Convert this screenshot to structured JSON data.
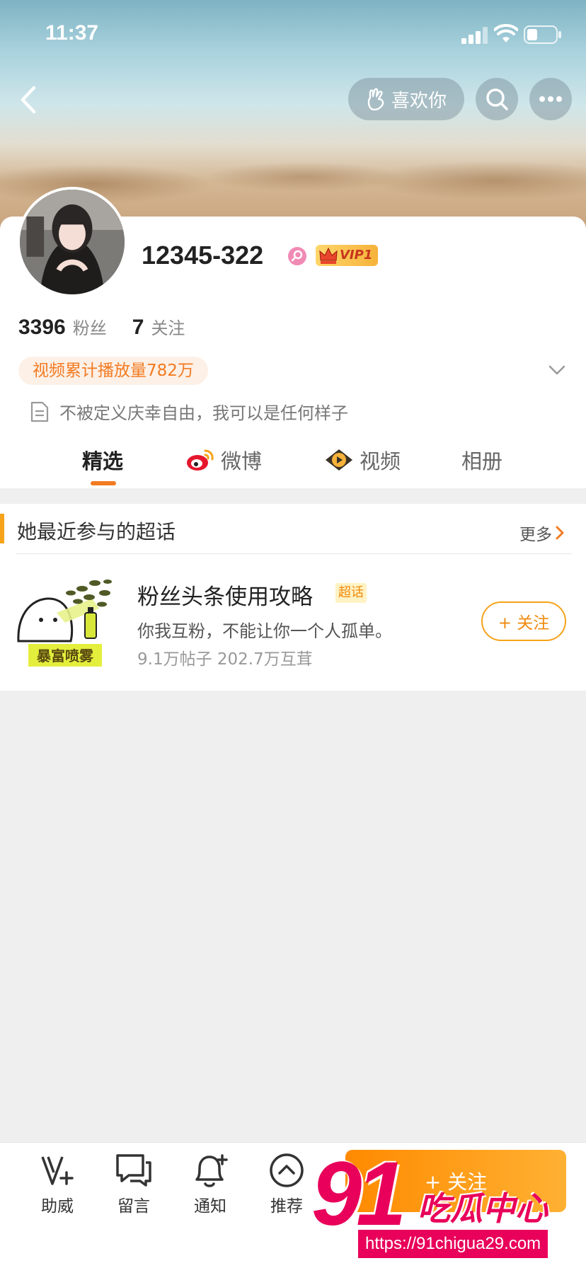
{
  "status_bar": {
    "time": "11:37"
  },
  "header": {
    "like_label": "喜欢你"
  },
  "profile": {
    "username": "12345-322",
    "vip_label": "VIP1",
    "followers_count": "3396",
    "followers_label": "粉丝",
    "following_count": "7",
    "following_label": "关注",
    "video_views": "视频累计播放量782万",
    "bio": "不被定义庆幸自由，我可以是任何样子"
  },
  "tabs": [
    {
      "label": "精选",
      "active": true
    },
    {
      "label": "微博",
      "active": false
    },
    {
      "label": "视频",
      "active": false
    },
    {
      "label": "相册",
      "active": false
    }
  ],
  "super_topics": {
    "title": "她最近参与的超话",
    "more_label": "更多",
    "items": [
      {
        "name": "粉丝头条使用攻略",
        "tag": "超话",
        "description": "你我互粉，不能让你一个人孤单。",
        "stats": "9.1万帖子 202.7万互茸",
        "thumb_text": "暴富喷雾",
        "follow_label": "+ 关注"
      }
    ]
  },
  "bottom_bar": {
    "items": [
      {
        "label": "助威",
        "icon": "v-plus-icon"
      },
      {
        "label": "留言",
        "icon": "message-icon"
      },
      {
        "label": "通知",
        "icon": "bell-plus-icon"
      },
      {
        "label": "推荐",
        "icon": "chevron-up-circle-icon"
      }
    ],
    "follow_label": "+ 关注"
  },
  "watermark": {
    "number": "91",
    "brand": "吃瓜中心",
    "url": "https://91chigua29.com"
  },
  "colors": {
    "accent": "#f27b22",
    "follow_gradient": "#ff8a00",
    "vip": "#f6b23a",
    "watermark": "#e8005a"
  }
}
